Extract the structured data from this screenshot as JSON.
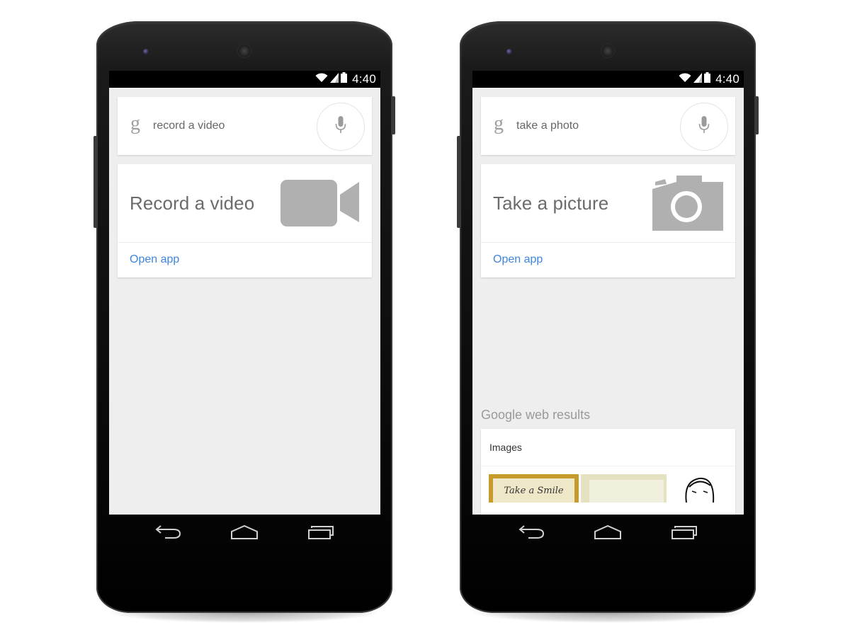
{
  "phones": [
    {
      "status_bar": {
        "time": "4:40",
        "icons": [
          "wifi-icon",
          "signal-icon",
          "battery-icon"
        ]
      },
      "search": {
        "logo": "g",
        "query": "record a video",
        "mic": "microphone-icon"
      },
      "action_card": {
        "title": "Record a video",
        "icon": "video-camera-icon",
        "open_app_label": "Open app"
      },
      "nav": [
        "back",
        "home",
        "recent-apps"
      ]
    },
    {
      "status_bar": {
        "time": "4:40",
        "icons": [
          "wifi-icon",
          "signal-icon",
          "battery-icon"
        ]
      },
      "search": {
        "logo": "g",
        "query": "take a photo",
        "mic": "microphone-icon"
      },
      "action_card": {
        "title": "Take a picture",
        "icon": "camera-icon",
        "open_app_label": "Open app"
      },
      "web_results": {
        "heading": "Google web results",
        "images_label": "Images",
        "thumbnails": [
          {
            "caption": "Take a Smile"
          },
          {
            "caption": ""
          },
          {
            "caption": ""
          }
        ]
      },
      "nav": [
        "back",
        "home",
        "recent-apps"
      ]
    }
  ],
  "colors": {
    "link": "#3b86dd",
    "icon_gray": "#b0b0b0",
    "screen_bg": "#eeeeee"
  }
}
